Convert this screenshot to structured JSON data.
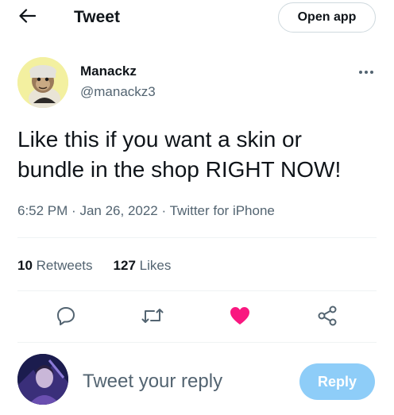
{
  "header": {
    "title": "Tweet",
    "back_icon": "arrow-left-icon",
    "open_app_label": "Open app"
  },
  "author": {
    "name": "Manackz",
    "handle": "@manackz3",
    "more_icon": "more-horizontal-icon"
  },
  "tweet": {
    "text_line1": "Like this if you want a skin or",
    "text_line2": "bundle in the shop RIGHT NOW!",
    "time": "6:52 PM",
    "separator": "·",
    "date": "Jan 26, 2022",
    "source": "Twitter for iPhone"
  },
  "stats": {
    "retweets_count": "10",
    "retweets_label": "Retweets",
    "likes_count": "127",
    "likes_label": "Likes"
  },
  "actions": {
    "reply_icon": "reply-icon",
    "retweet_icon": "retweet-icon",
    "like_icon": "heart-icon",
    "share_icon": "share-icon",
    "liked": true
  },
  "composer": {
    "placeholder": "Tweet your reply",
    "reply_label": "Reply"
  },
  "colors": {
    "text_primary": "#0f1419",
    "text_secondary": "#536471",
    "like_active": "#f91880",
    "reply_button": "#8ecdf8",
    "divider": "#eff3f4"
  }
}
